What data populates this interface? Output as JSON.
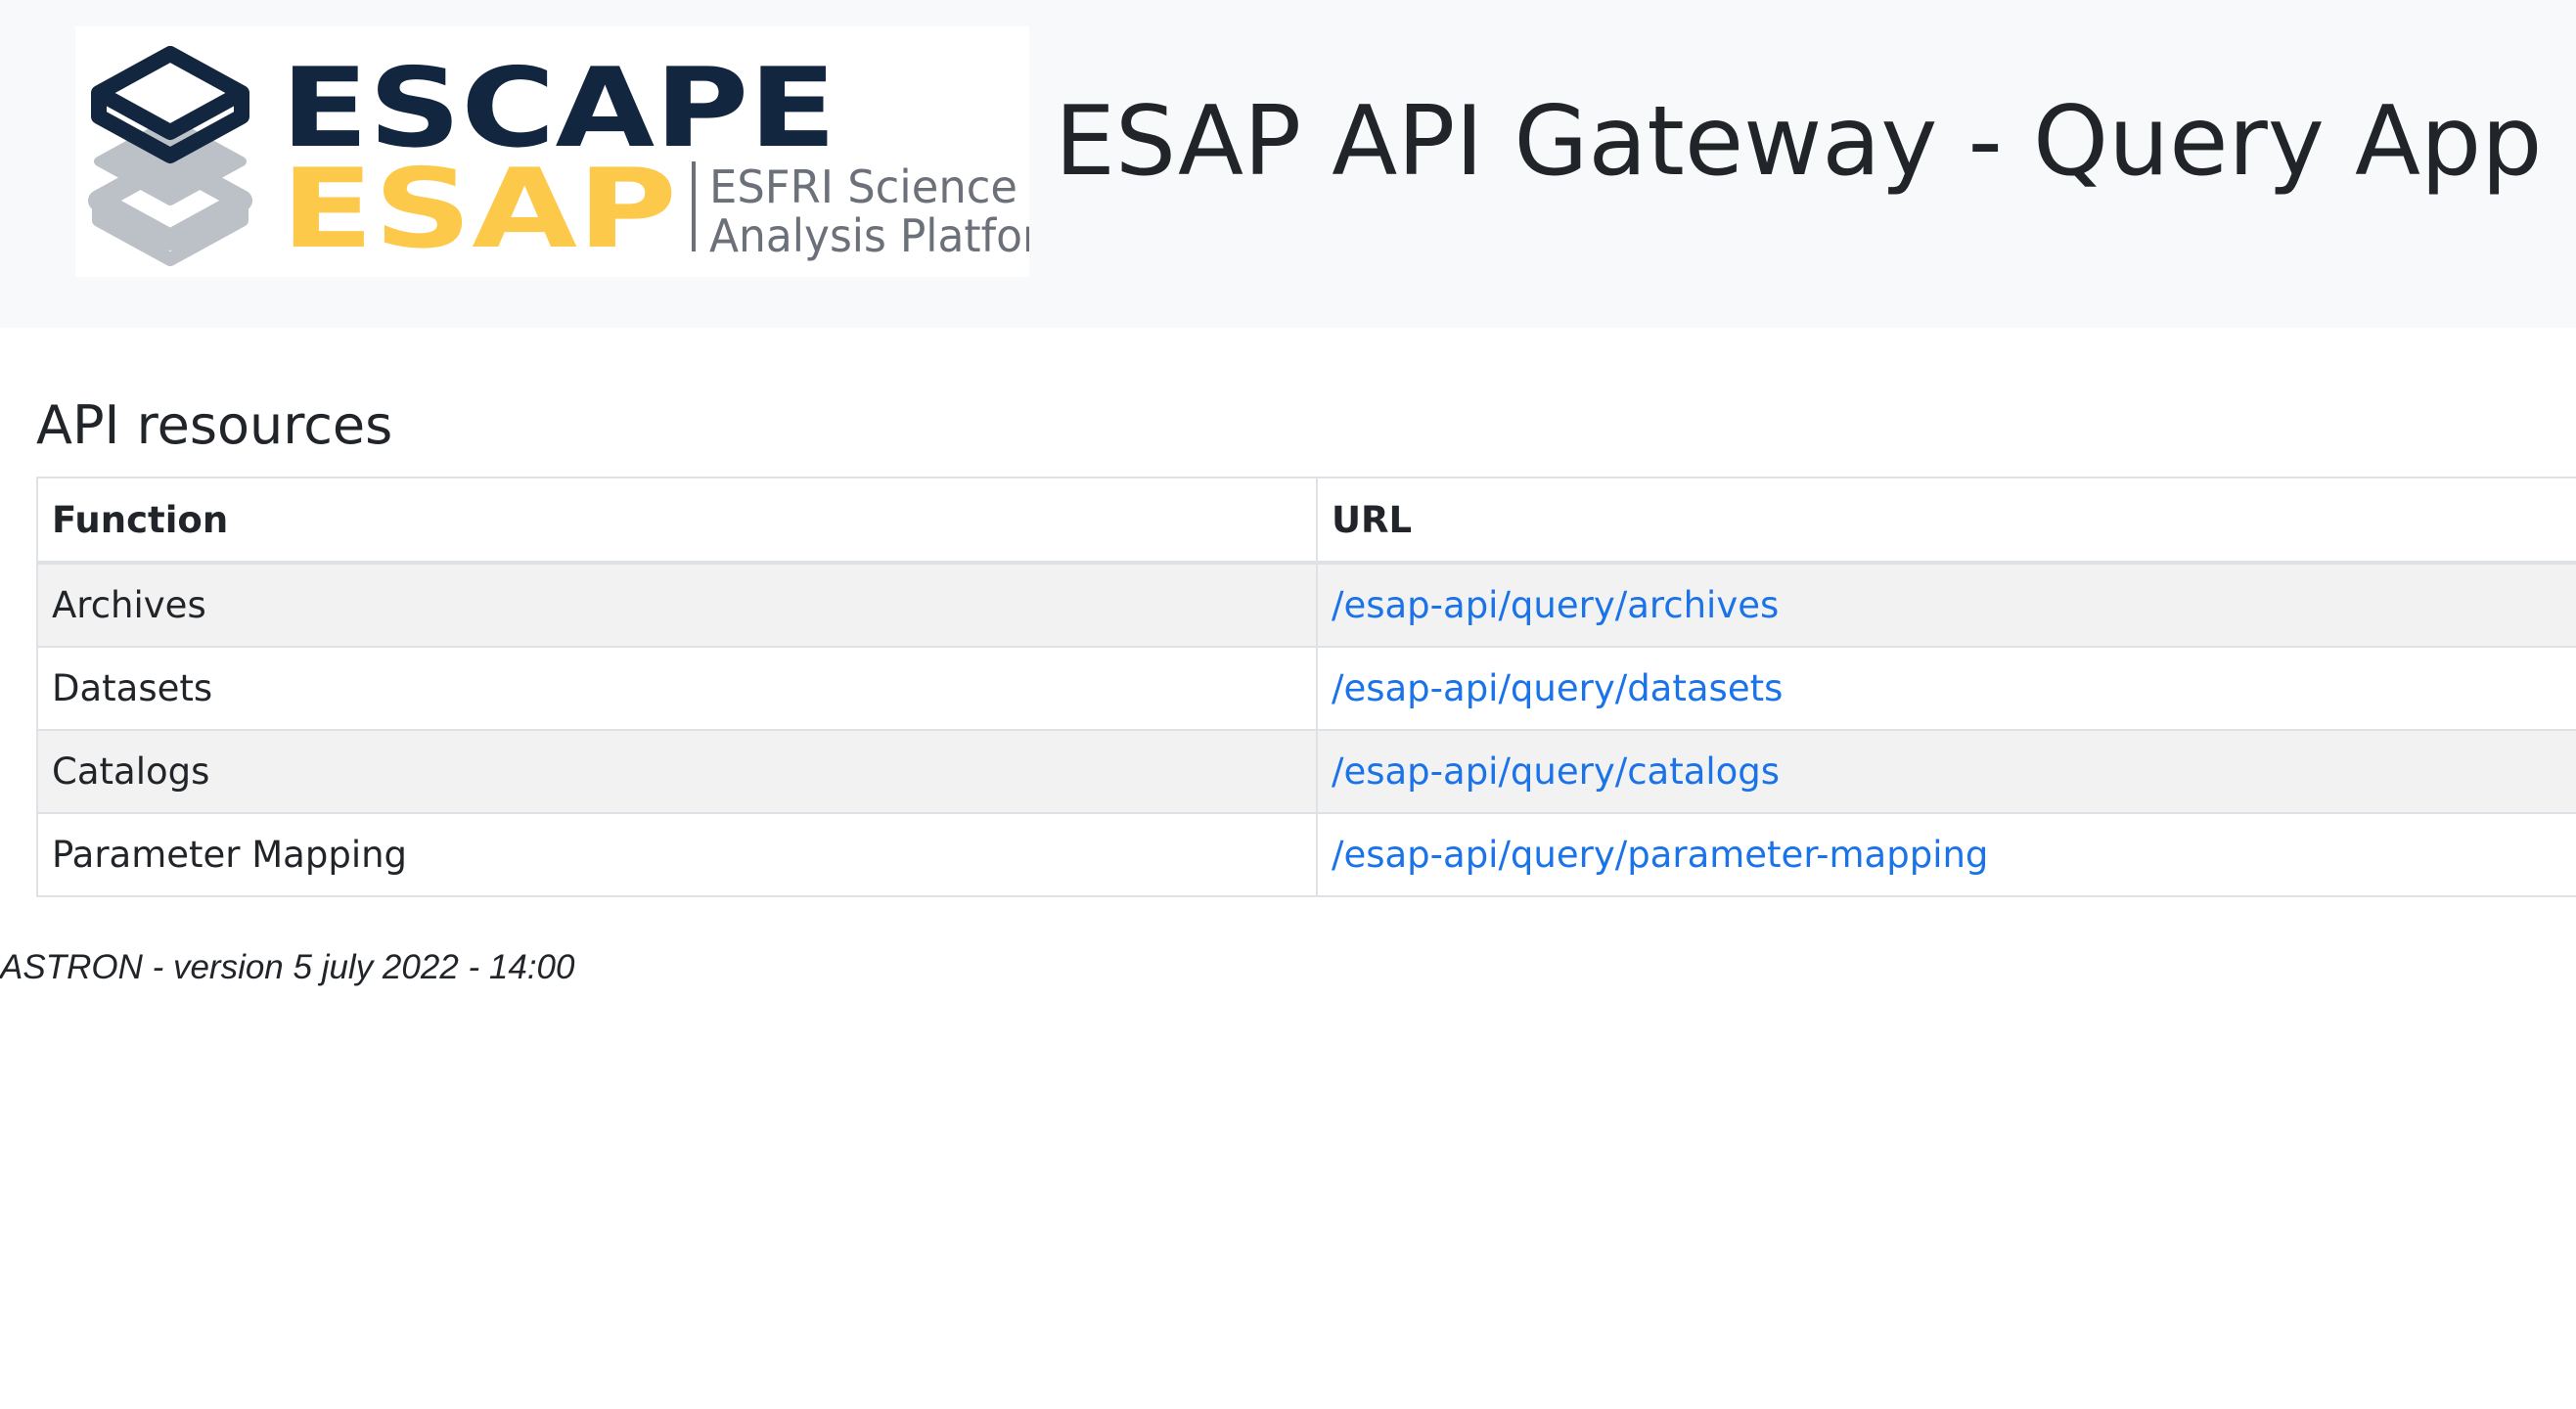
{
  "header": {
    "logo": {
      "brand_top": "ESCAPE",
      "brand_bottom": "ESAP",
      "tagline_line1": "ESFRI Science",
      "tagline_line2": "Analysis Platform",
      "colors": {
        "navy": "#13263f",
        "yellow": "#fcc94a",
        "grey": "#bcc1c7",
        "tagline": "#6b7079"
      }
    },
    "title": "ESAP API Gateway - Query App"
  },
  "main": {
    "section_title": "API resources",
    "table": {
      "columns": [
        "Function",
        "URL"
      ],
      "rows": [
        {
          "function": "Archives",
          "url": "/esap-api/query/archives"
        },
        {
          "function": "Datasets",
          "url": "/esap-api/query/datasets"
        },
        {
          "function": "Catalogs",
          "url": "/esap-api/query/catalogs"
        },
        {
          "function": "Parameter Mapping",
          "url": "/esap-api/query/parameter-mapping"
        }
      ]
    }
  },
  "footer": {
    "text": "ASTRON - version 5 july 2022 - 14:00"
  },
  "colors": {
    "link": "#1a73e8",
    "header_bg": "#f8f9fa",
    "striped_row": "#f2f2f2",
    "border": "#dee2e6"
  }
}
